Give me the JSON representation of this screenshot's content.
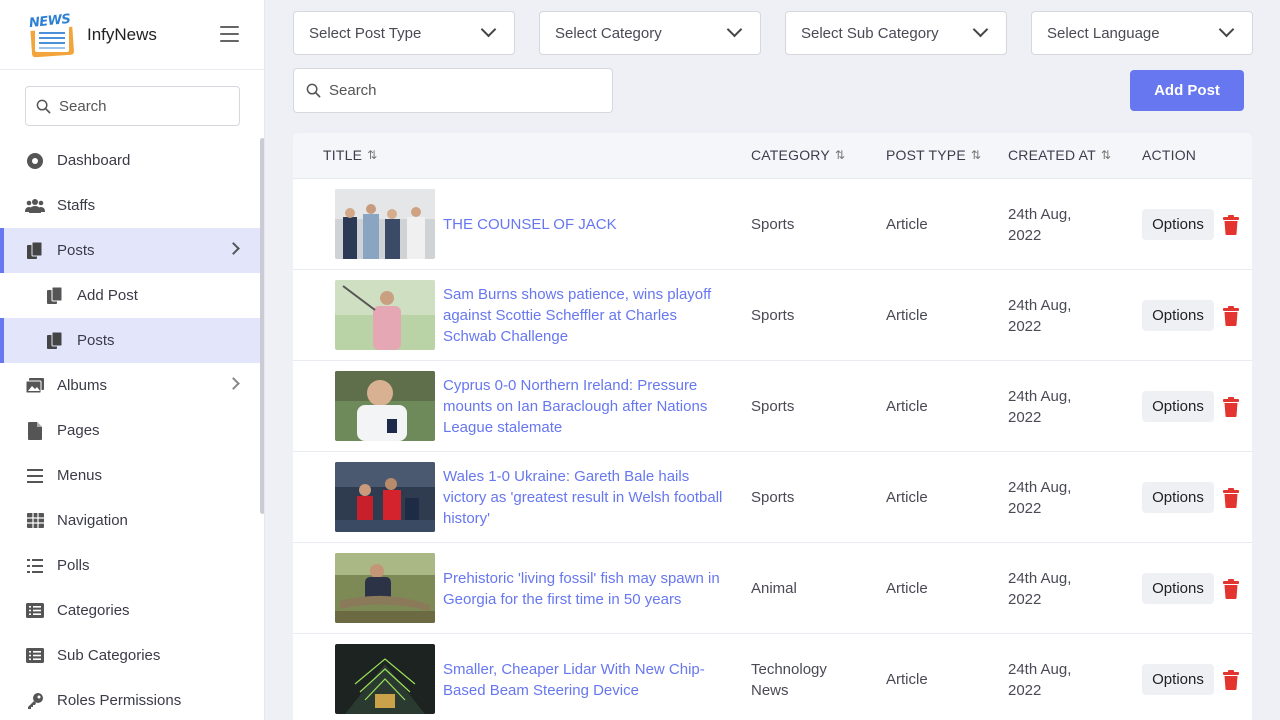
{
  "brand": {
    "name": "InfyNews",
    "logo_tag": "NEWS"
  },
  "sidebar": {
    "search_placeholder": "Search",
    "items": [
      {
        "label": "Dashboard",
        "icon": "dashboard-icon"
      },
      {
        "label": "Staffs",
        "icon": "users-icon"
      },
      {
        "label": "Posts",
        "icon": "copy-icon",
        "active": true
      },
      {
        "label": "Add Post",
        "icon": "copy-icon",
        "sub": true
      },
      {
        "label": "Posts",
        "icon": "copy-icon",
        "sub": true,
        "active": true
      },
      {
        "label": "Albums",
        "icon": "images-icon"
      },
      {
        "label": "Pages",
        "icon": "file-icon"
      },
      {
        "label": "Menus",
        "icon": "bars-icon"
      },
      {
        "label": "Navigation",
        "icon": "grid-icon"
      },
      {
        "label": "Polls",
        "icon": "list-icon"
      },
      {
        "label": "Categories",
        "icon": "list-alt-icon"
      },
      {
        "label": "Sub Categories",
        "icon": "list-alt-icon"
      },
      {
        "label": "Roles Permissions",
        "icon": "key-icon"
      }
    ]
  },
  "filters": {
    "post_type": "Select Post Type",
    "category": "Select Category",
    "sub_category": "Select Sub Category",
    "language": "Select Language"
  },
  "search_placeholder": "Search",
  "add_post_label": "Add Post",
  "table": {
    "headers": {
      "title": "TITLE",
      "category": "CATEGORY",
      "post_type": "POST TYPE",
      "created_at": "CREATED AT",
      "action": "ACTION"
    },
    "options_label": "Options",
    "rows": [
      {
        "title": "THE COUNSEL OF JACK",
        "category": "Sports",
        "post_type": "Article",
        "created_at": "24th Aug, 2022"
      },
      {
        "title": "Sam Burns shows patience, wins playoff against Scottie Scheffler at Charles Schwab Challenge",
        "category": "Sports",
        "post_type": "Article",
        "created_at": "24th Aug, 2022"
      },
      {
        "title": "Cyprus 0-0 Northern Ireland: Pressure mounts on Ian Baraclough after Nations League stalemate",
        "category": "Sports",
        "post_type": "Article",
        "created_at": "24th Aug, 2022"
      },
      {
        "title": "Wales 1-0 Ukraine: Gareth Bale hails victory as 'greatest result in Welsh football history'",
        "category": "Sports",
        "post_type": "Article",
        "created_at": "24th Aug, 2022"
      },
      {
        "title": "Prehistoric 'living fossil' fish may spawn in Georgia for the first time in 50 years",
        "category": "Animal",
        "post_type": "Article",
        "created_at": "24th Aug, 2022"
      },
      {
        "title": "Smaller, Cheaper Lidar With New Chip-Based Beam Steering Device",
        "category": "Technology News",
        "post_type": "Article",
        "created_at": "24th Aug, 2022"
      }
    ]
  },
  "colors": {
    "accent": "#6777ef",
    "danger": "#e3342f",
    "active_bg": "#e3e5fb"
  }
}
